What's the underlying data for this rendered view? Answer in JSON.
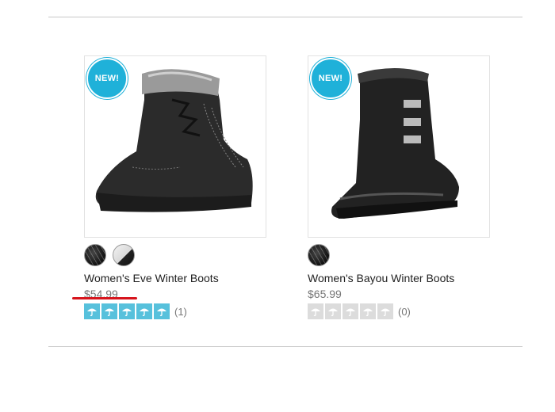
{
  "products": [
    {
      "badge": "NEW!",
      "name": "Women's Eve Winter Boots",
      "price": "$54.99",
      "swatches": [
        "black",
        "white"
      ],
      "rating": 5,
      "review_count": "(1)"
    },
    {
      "badge": "NEW!",
      "name": "Women's Bayou Winter Boots",
      "price": "$65.99",
      "swatches": [
        "black"
      ],
      "rating": 0,
      "review_count": "(0)"
    }
  ],
  "colors": {
    "badge": "#1fb1d9",
    "rating_on": "#57c1dc",
    "rating_off": "#dcdcdc",
    "annotation_underline": "#d6141c"
  },
  "icons": {
    "rating": "umbrella-icon"
  }
}
